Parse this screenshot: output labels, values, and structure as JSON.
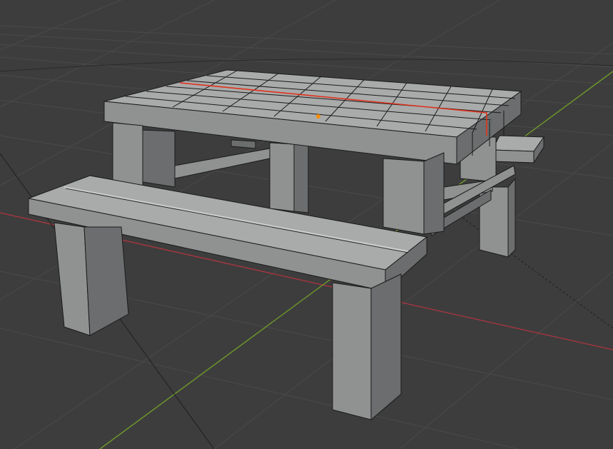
{
  "viewport": {
    "mode": "3d-viewport",
    "background_color": "#3d3d3d"
  },
  "grid": {
    "line_color": "#4a4a4a",
    "x_axis_color": "#a6363f",
    "y_axis_color": "#6e9a2a"
  },
  "object": {
    "name_icon": "picnic-table-mesh",
    "face_light": "#a9abab",
    "face_mid": "#909292",
    "face_dark": "#6b6d6e",
    "face_shadow": "#555758",
    "edge_color": "#1a1a1a",
    "selected_edge_color": "#e0321c",
    "origin_color": "#ff8c00"
  }
}
